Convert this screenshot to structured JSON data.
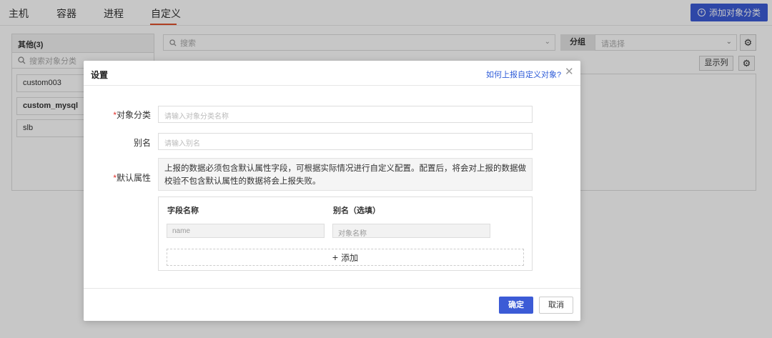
{
  "nav": {
    "tabs": [
      {
        "label": "主机"
      },
      {
        "label": "容器"
      },
      {
        "label": "进程"
      },
      {
        "label": "自定义"
      }
    ],
    "active_tab": "自定义",
    "add_button": "添加对象分类"
  },
  "sidebar": {
    "header": "其他(3)",
    "search_placeholder": "搜索对象分类",
    "items": [
      {
        "label": "custom003"
      },
      {
        "label": "custom_mysql"
      },
      {
        "label": "slb"
      }
    ]
  },
  "toolbar": {
    "search_placeholder": "搜索",
    "group_label": "分组",
    "group_placeholder": "请选择",
    "columns_button": "显示列"
  },
  "modal": {
    "title": "设置",
    "help_link": "如何上报自定义对象?",
    "fields": {
      "category_label": "对象分类",
      "category_placeholder": "请输入对象分类名称",
      "alias_label": "别名",
      "alias_placeholder": "请输入别名",
      "default_attr_label": "默认属性",
      "required_mark": "*"
    },
    "hint": "上报的数据必须包含默认属性字段，可根据实际情况进行自定义配置。配置后，将会对上报的数据做校验不包含默认属性的数据将会上报失败。",
    "table": {
      "col_field": "字段名称",
      "col_alias": "别名（选填）",
      "row_field_value": "name",
      "row_alias_placeholder": "对象名称",
      "add_label": "添加"
    },
    "ok_button": "确定",
    "cancel_button": "取消"
  },
  "colors": {
    "primary": "#3c5bd6",
    "active_tab_underline": "#e0512c",
    "required": "#e0312c",
    "link": "#2d5bd8"
  }
}
